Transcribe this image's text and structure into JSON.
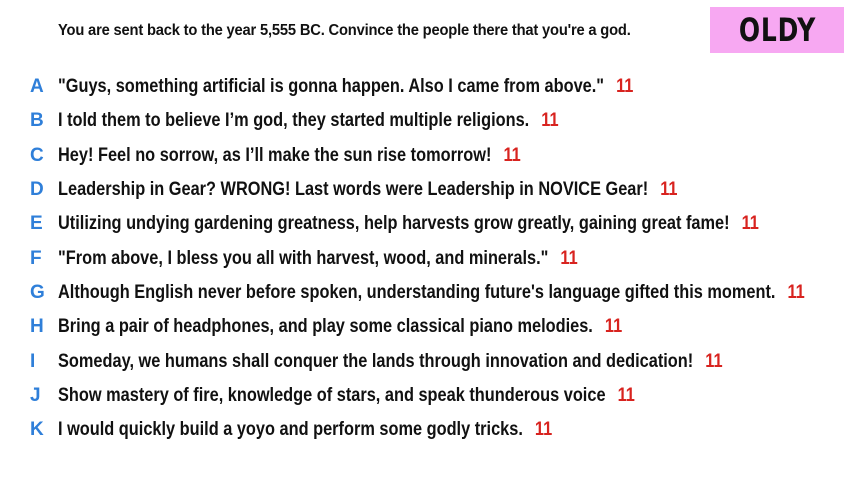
{
  "prompt": "You are sent back to the year 5,555 BC. Convince the people there that you're a god.",
  "badge": {
    "label": "OLDY",
    "color": "#f7a8f2"
  },
  "colors": {
    "letter": "#2f7fd9",
    "score": "#d8231f"
  },
  "answers": [
    {
      "letter": "A",
      "text": "\"Guys, something artificial is gonna happen. Also I came from above.\"",
      "score": "11"
    },
    {
      "letter": "B",
      "text": "I told them to believe I’m god, they started multiple religions.",
      "score": "11"
    },
    {
      "letter": "C",
      "text": "Hey! Feel no sorrow, as I’ll make the sun rise tomorrow!",
      "score": "11"
    },
    {
      "letter": "D",
      "text": "Leadership in Gear? WRONG! Last words were Leadership in NOVICE Gear!",
      "score": "11"
    },
    {
      "letter": "E",
      "text": "Utilizing undying gardening greatness, help harvests grow greatly, gaining great fame!",
      "score": "11"
    },
    {
      "letter": "F",
      "text": "\"From above, I bless you all with harvest, wood, and minerals.\"",
      "score": "11"
    },
    {
      "letter": "G",
      "text": "Although English never before spoken, understanding future's language gifted this moment.",
      "score": "11"
    },
    {
      "letter": "H",
      "text": "Bring a pair of headphones, and play some classical piano melodies.",
      "score": "11"
    },
    {
      "letter": "I",
      "text": "Someday, we humans shall conquer the lands through innovation and dedication!",
      "score": "11"
    },
    {
      "letter": "J",
      "text": "Show mastery of fire, knowledge of stars, and speak thunderous voice",
      "score": "11"
    },
    {
      "letter": "K",
      "text": "I would quickly build a yoyo and perform some godly tricks.",
      "score": "11"
    }
  ]
}
